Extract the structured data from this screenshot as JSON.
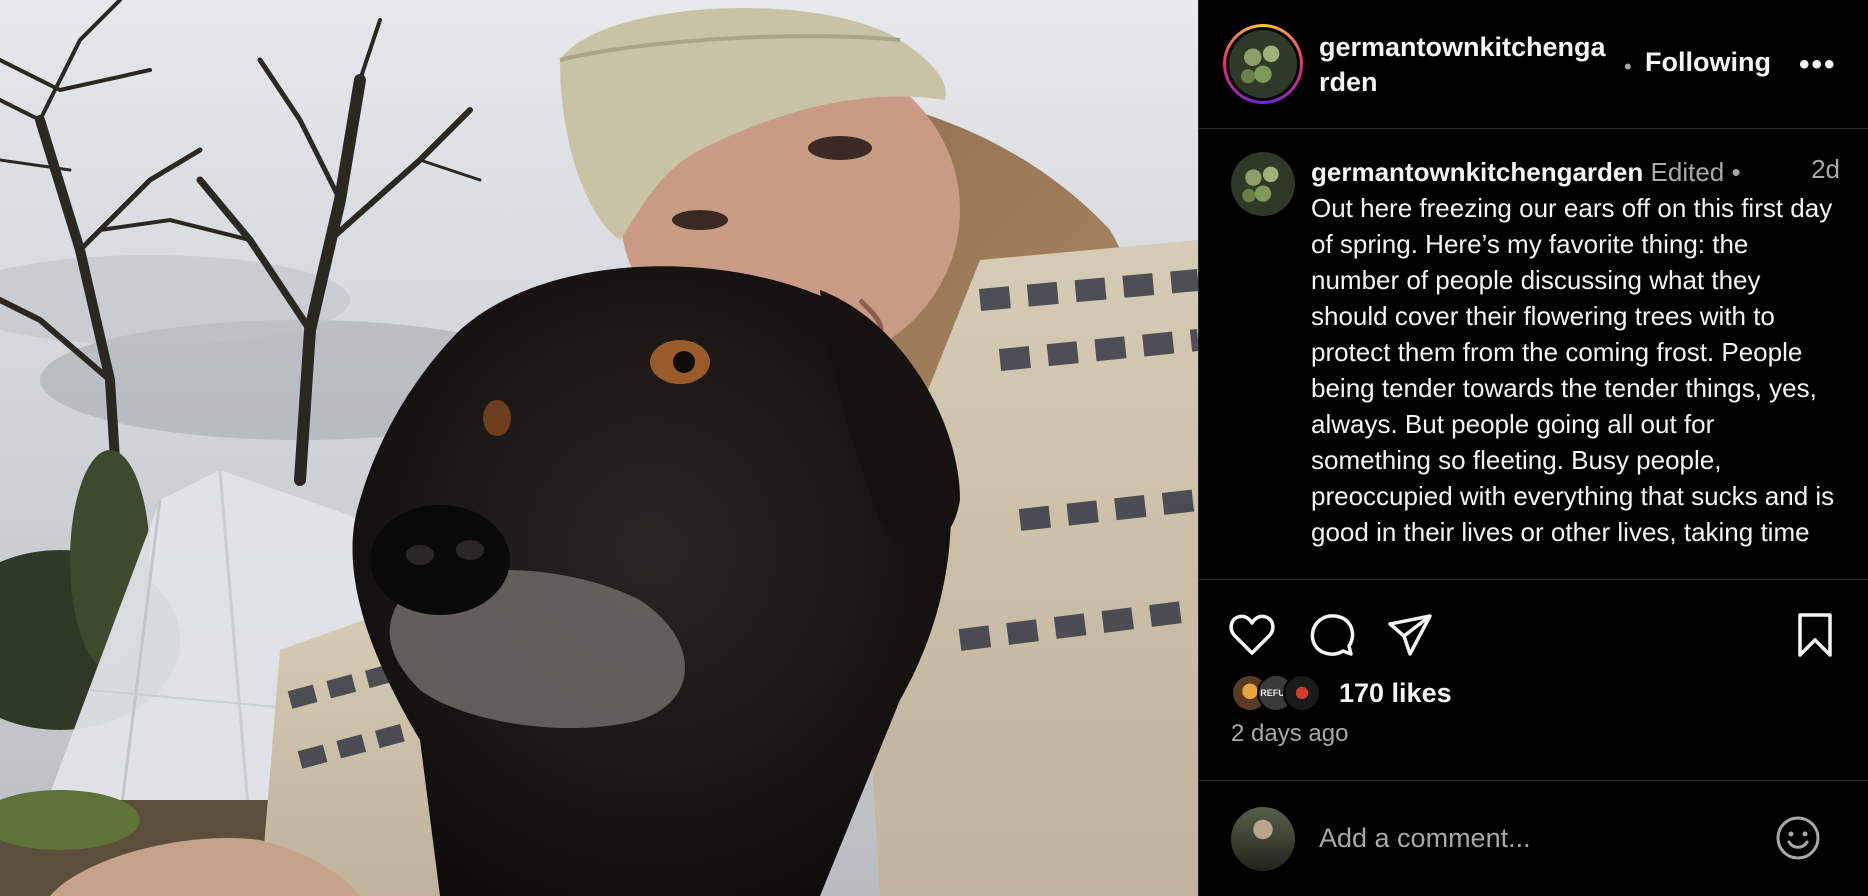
{
  "post": {
    "username": "germantownkitchengarden",
    "follow_state": "Following",
    "more_label": "•••",
    "separator": "•"
  },
  "caption": {
    "username": "germantownkitchengarden",
    "edited_label": "Edited",
    "separator": "•",
    "time": "2d",
    "text": "Out here freezing our ears off on this first day of spring. Here’s my favorite thing: the number of people discussing what they should cover their flowering trees with to protect them from the coming frost. People being tender towards the tender things, yes, always. But people going all out for something so fleeting. Busy people, preoccupied with everything that sucks and is good in their lives or other lives, taking time"
  },
  "actions": {
    "like_icon": "heart-icon",
    "comment_icon": "comment-icon",
    "share_icon": "share-icon",
    "save_icon": "bookmark-icon"
  },
  "likes": {
    "count_label": "170 likes",
    "liker_avatar_2_text": "REFUG"
  },
  "timestamp": "2 days ago",
  "comment": {
    "placeholder": "Add a comment...",
    "emoji_icon": "emoji-icon"
  },
  "colors": {
    "background": "#000000",
    "text": "#f5f5f5",
    "secondary_text": "#a8a8a8",
    "divider": "#262626"
  }
}
